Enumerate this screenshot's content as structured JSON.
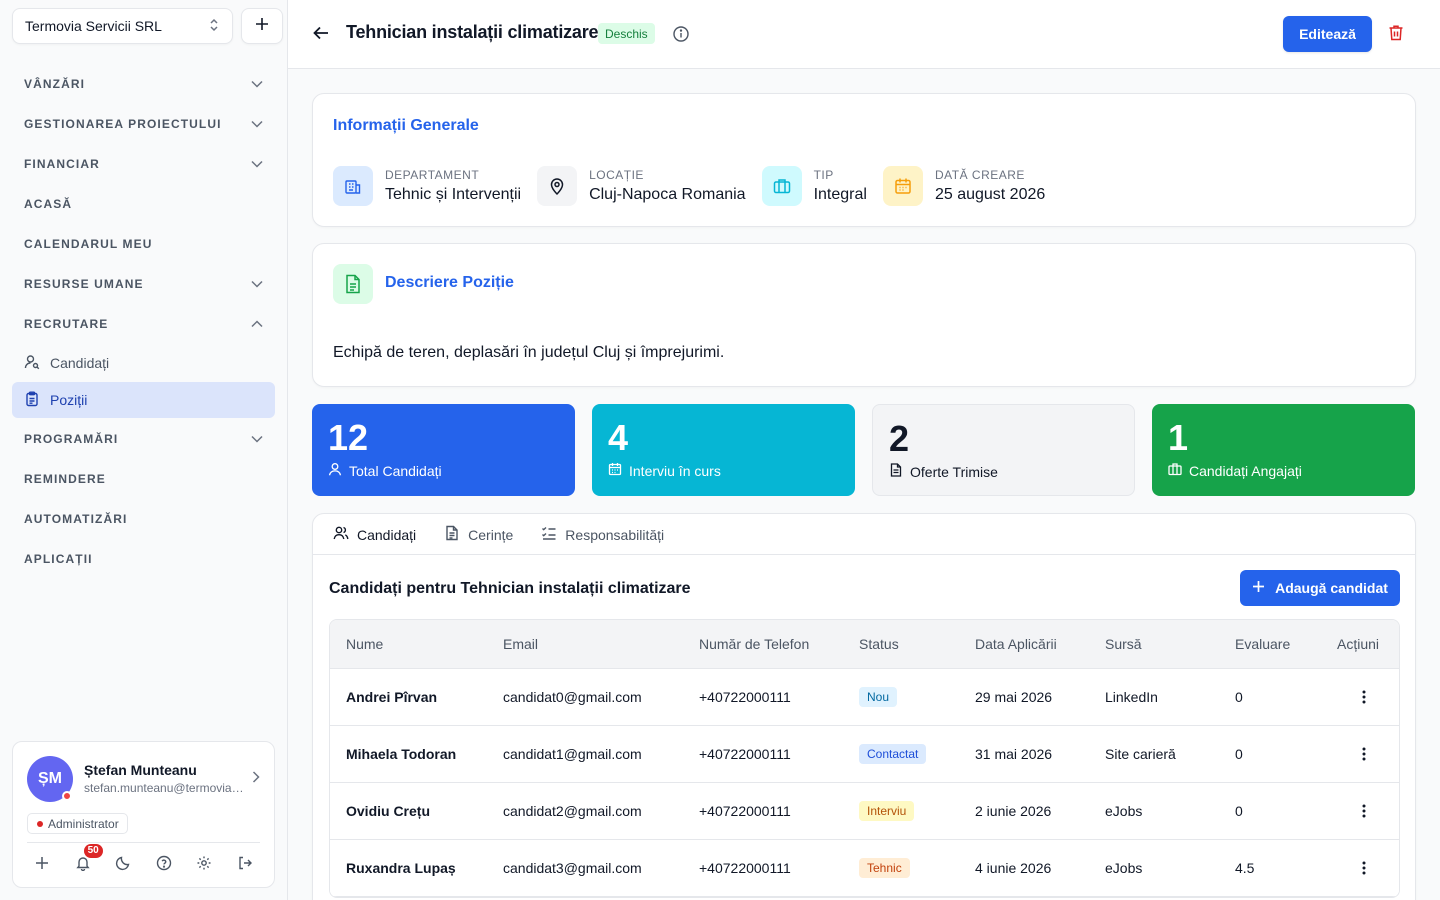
{
  "company": {
    "name": "Termovia Servicii SRL"
  },
  "nav": {
    "vanzari": "VÂNZĂRI",
    "proiect": "GESTIONAREA PROIECTULUI",
    "financiar": "FINANCIAR",
    "acasa": "ACASĂ",
    "calendar": "CALENDARUL MEU",
    "resurse": "RESURSE UMANE",
    "recrutare": "RECRUTARE",
    "candidati": "Candidați",
    "pozitii": "Poziții",
    "programari": "PROGRAMĂRI",
    "remindere": "REMINDERE",
    "automatizari": "AUTOMATIZĂRI",
    "aplicatii": "APLICAȚII"
  },
  "user": {
    "initials": "ȘM",
    "name": "Ștefan Munteanu",
    "email": "stefan.munteanu@termovia.ro",
    "role": "Administrator",
    "notifications": "50"
  },
  "header": {
    "title": "Tehnician instalații climatizare",
    "status": "Deschis",
    "edit_label": "Editează"
  },
  "info": {
    "title": "Informații Generale",
    "department_label": "DEPARTAMENT",
    "department": "Tehnic și Intervenții",
    "location_label": "LOCAȚIE",
    "location": "Cluj-Napoca Romania",
    "type_label": "TIP",
    "type": "Integral",
    "date_label": "DATĂ CREARE",
    "date": "25 august 2026"
  },
  "description": {
    "title": "Descriere Poziție",
    "text": "Echipă de teren, deplasări în județul Cluj și împrejurimi."
  },
  "stats": [
    {
      "value": "12",
      "label": "Total Candidați"
    },
    {
      "value": "4",
      "label": "Interviu în curs"
    },
    {
      "value": "2",
      "label": "Oferte Trimise"
    },
    {
      "value": "1",
      "label": "Candidați Angajați"
    }
  ],
  "tabs": [
    "Candidați",
    "Cerințe",
    "Responsabilități"
  ],
  "candidates": {
    "title": "Candidați pentru Tehnician instalații climatizare",
    "add_label": "Adaugă candidat",
    "columns": [
      "Nume",
      "Email",
      "Număr de Telefon",
      "Status",
      "Data Aplicării",
      "Sursă",
      "Evaluare",
      "Acțiuni"
    ],
    "rows": [
      {
        "name": "Andrei Pîrvan",
        "email": "candidat0@gmail.com",
        "phone": "+40722000111",
        "status": "Nou",
        "date": "29 mai 2026",
        "source": "LinkedIn",
        "rating": "0"
      },
      {
        "name": "Mihaela Todoran",
        "email": "candidat1@gmail.com",
        "phone": "+40722000111",
        "status": "Contactat",
        "date": "31 mai 2026",
        "source": "Site carieră",
        "rating": "0"
      },
      {
        "name": "Ovidiu Crețu",
        "email": "candidat2@gmail.com",
        "phone": "+40722000111",
        "status": "Interviu",
        "date": "2 iunie 2026",
        "source": "eJobs",
        "rating": "0"
      },
      {
        "name": "Ruxandra Lupaș",
        "email": "candidat3@gmail.com",
        "phone": "+40722000111",
        "status": "Tehnic",
        "date": "4 iunie 2026",
        "source": "eJobs",
        "rating": "4.5"
      }
    ]
  },
  "colors": {
    "primary": "#2563eb",
    "cyan": "#06b6d4",
    "green": "#16a34a",
    "danger": "#dc2626"
  }
}
